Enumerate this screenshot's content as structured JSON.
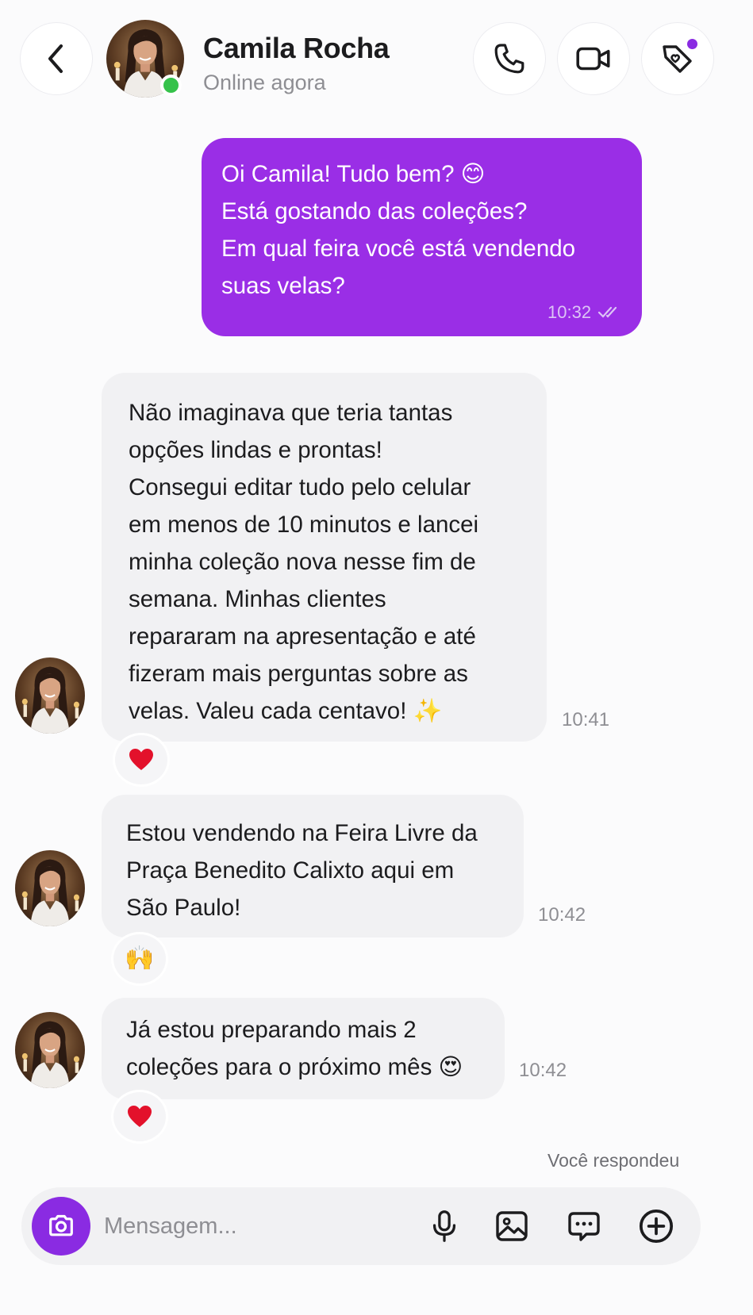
{
  "header": {
    "contact_name": "Camila Rocha",
    "status": "Online agora",
    "online_color": "#35c24a"
  },
  "messages": [
    {
      "direction": "outgoing",
      "text": "Oi Camila! Tudo bem? 😊\nEstá gostando das coleções?\nEm qual feira você está vendendo\nsuas velas?",
      "time": "10:32",
      "read_status": "read-double-check"
    },
    {
      "direction": "incoming",
      "text": "Não imaginava que teria tantas\nopções lindas e prontas!\nConsegui editar tudo pelo celular\nem menos de 10 minutos e lancei\nminha coleção nova nesse fim de\nsemana. Minhas clientes\nrepararam na apresentação e até\nfizeram mais perguntas sobre as\nvelas. Valeu cada centavo! ✨",
      "time": "10:41",
      "reaction": "❤️"
    },
    {
      "direction": "incoming",
      "text": "Estou vendendo na Feira Livre da\nPraça Benedito Calixto aqui em\nSão Paulo!",
      "time": "10:42",
      "reaction": "🙌"
    },
    {
      "direction": "incoming",
      "text": "Já estou preparando mais 2\ncoleções para o próximo mês 😍",
      "time": "10:42",
      "reaction": "❤️"
    }
  ],
  "replied_label": "Você respondeu",
  "composer": {
    "placeholder": "Mensagem..."
  },
  "icons": {
    "back": "chevron-left-icon",
    "call": "phone-icon",
    "video": "video-camera-icon",
    "tag": "heart-tag-icon",
    "camera": "camera-icon",
    "mic": "microphone-icon",
    "gallery": "image-icon",
    "chat": "chat-bubble-icon",
    "plus": "plus-circle-icon"
  },
  "colors": {
    "accent": "#8a2be2",
    "outgoing_bubble": "#9a2ee6",
    "incoming_bubble": "#f1f1f3"
  }
}
